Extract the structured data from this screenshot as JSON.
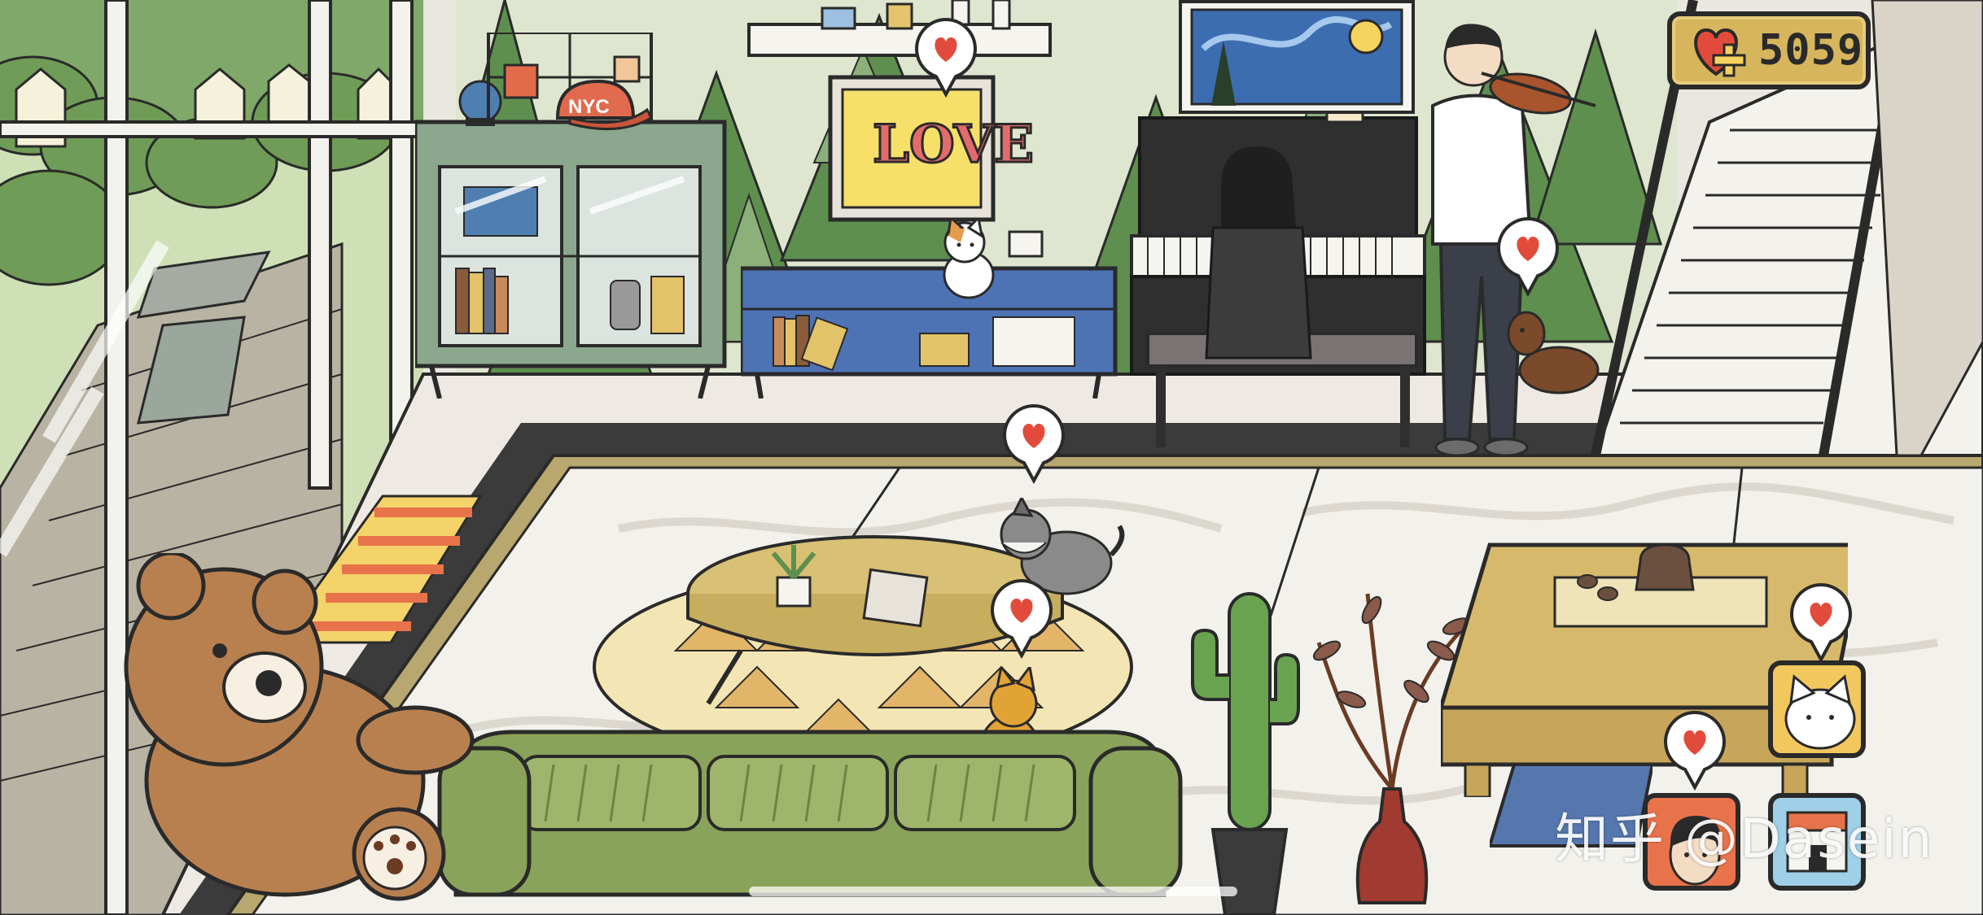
{
  "hud": {
    "hearts_count": "5059",
    "hearts_icon": "heart-plus-icon"
  },
  "watermark": {
    "platform": "知乎",
    "handle": "@Dasein"
  },
  "tv": {
    "screen_text": "LOVE"
  },
  "cap": {
    "text": "NYC"
  },
  "colors": {
    "wall_green": "#5e8f4f",
    "floor": "#eeeae3",
    "rug_border": "#b8a76e",
    "sofa_green": "#8aa35a",
    "hud_gold": "#d6b55d",
    "heart_red": "#e24b3b",
    "outline": "#2a2a2a"
  },
  "friend_buttons": [
    {
      "name": "friend-cat-button",
      "icon": "white-cat-face-icon"
    },
    {
      "name": "friend-man-button",
      "icon": "man-portrait-icon"
    },
    {
      "name": "friend-house-button",
      "icon": "house-icon"
    }
  ]
}
